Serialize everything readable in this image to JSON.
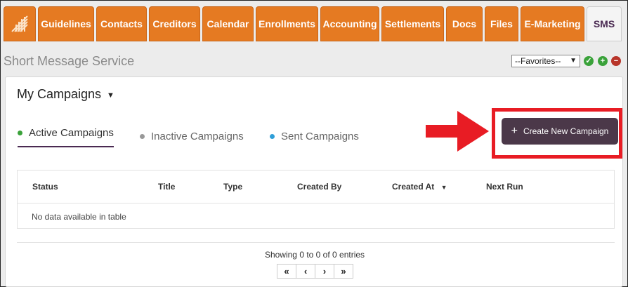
{
  "nav": {
    "tabs": [
      {
        "label": "Guidelines"
      },
      {
        "label": "Contacts"
      },
      {
        "label": "Creditors"
      },
      {
        "label": "Calendar"
      },
      {
        "label": "Enrollments"
      },
      {
        "label": "Accounting"
      },
      {
        "label": "Settlements"
      },
      {
        "label": "Docs"
      },
      {
        "label": "Files"
      },
      {
        "label": "E-Marketing"
      },
      {
        "label": "SMS",
        "active": true
      }
    ],
    "logo_icon": "company-logo-icon"
  },
  "page": {
    "title": "Short Message Service",
    "favorites": "--Favorites--"
  },
  "campaigns": {
    "heading": "My Campaigns",
    "tabs": [
      {
        "label": "Active Campaigns",
        "dot_color": "#3aa23a"
      },
      {
        "label": "Inactive Campaigns",
        "dot_color": "#999999"
      },
      {
        "label": "Sent Campaigns",
        "dot_color": "#2f9fd8"
      }
    ],
    "create_button": "Create New Campaign"
  },
  "table": {
    "columns": [
      "Status",
      "Title",
      "Type",
      "Created By",
      "Created At",
      "Next Run"
    ],
    "empty_text": "No data available in table",
    "info": "Showing 0 to 0 of 0 entries",
    "pager": [
      "«",
      "‹",
      "›",
      "»"
    ]
  },
  "colors": {
    "nav_orange": "#e57a22",
    "brand_purple": "#4b3849",
    "highlight_red": "#e81c24",
    "ok_green": "#3aa23a",
    "cancel_red": "#b8352a"
  }
}
